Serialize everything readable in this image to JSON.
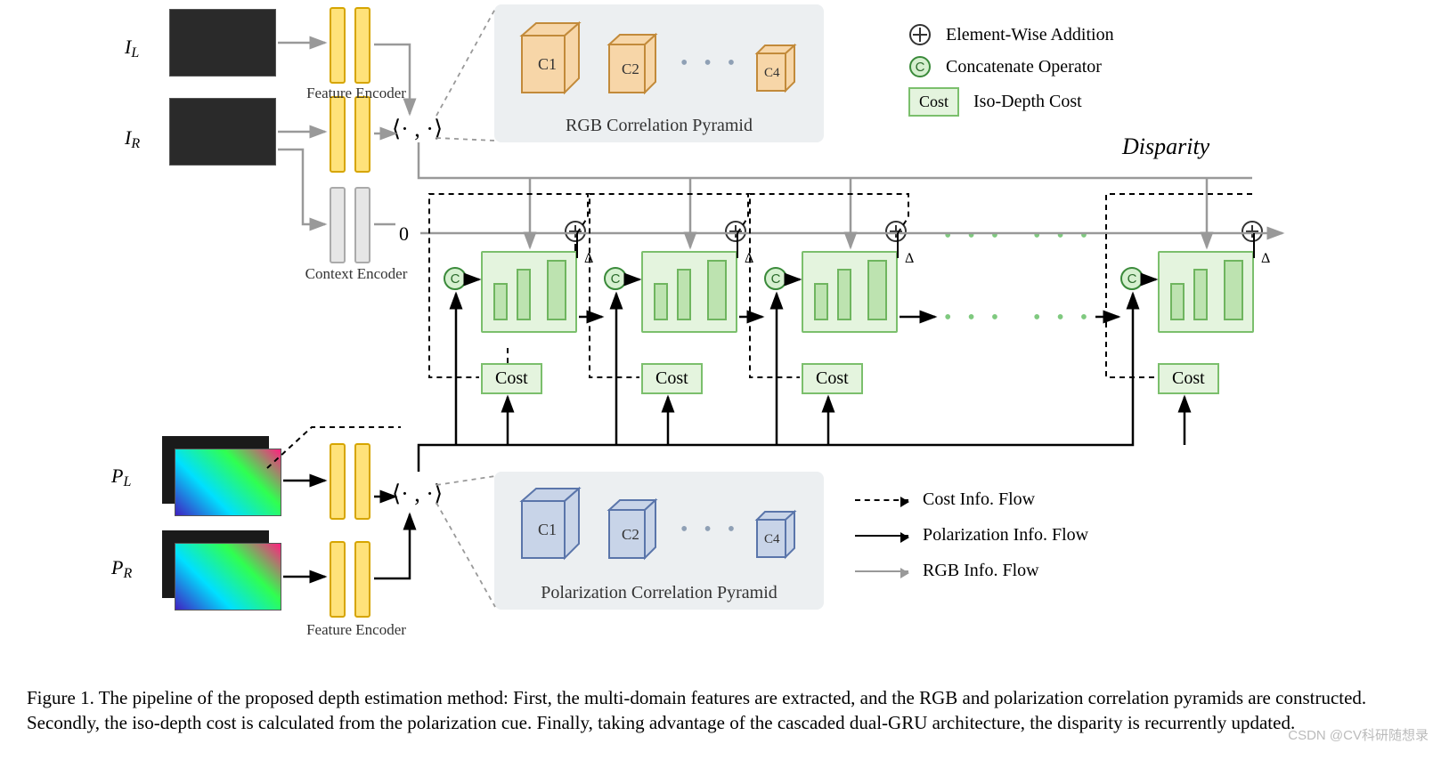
{
  "inputs": {
    "IL": "I",
    "IL_sub": "L",
    "IR": "I",
    "IR_sub": "R",
    "PL": "P",
    "PL_sub": "L",
    "PR": "P",
    "PR_sub": "R"
  },
  "encoders": {
    "feature": "Feature Encoder",
    "context": "Context Encoder"
  },
  "inner_product": "⟨· , ·⟩",
  "rgb_pyramid": {
    "label": "RGB Correlation Pyramid",
    "c1": "C1",
    "c2": "C2",
    "c4": "C4",
    "dots": "• • •"
  },
  "pol_pyramid": {
    "label": "Polarization Correlation Pyramid",
    "c1": "C1",
    "c2": "C2",
    "c4": "C4",
    "dots": "• • •"
  },
  "legend": {
    "add": "Element-Wise Addition",
    "concat": "Concatenate Operator",
    "cost": "Iso-Depth Cost",
    "cost_label": "Cost",
    "flow_cost": "Cost Info. Flow",
    "flow_pol": "Polarization Info. Flow",
    "flow_rgb": "RGB Info. Flow"
  },
  "pipeline": {
    "zero": "0",
    "delta": "Δ",
    "c": "C",
    "cost": "Cost",
    "disparity": "Disparity",
    "green_dots": "• • •"
  },
  "caption": "Figure 1. The pipeline of the proposed depth estimation method: First, the multi-domain features are extracted, and the RGB and polarization correlation pyramids are constructed. Secondly, the iso-depth cost is calculated from the polarization cue. Finally, taking advantage of the cascaded dual-GRU architecture, the disparity is recurrently updated.",
  "watermark": "CSDN @CV科研随想录"
}
